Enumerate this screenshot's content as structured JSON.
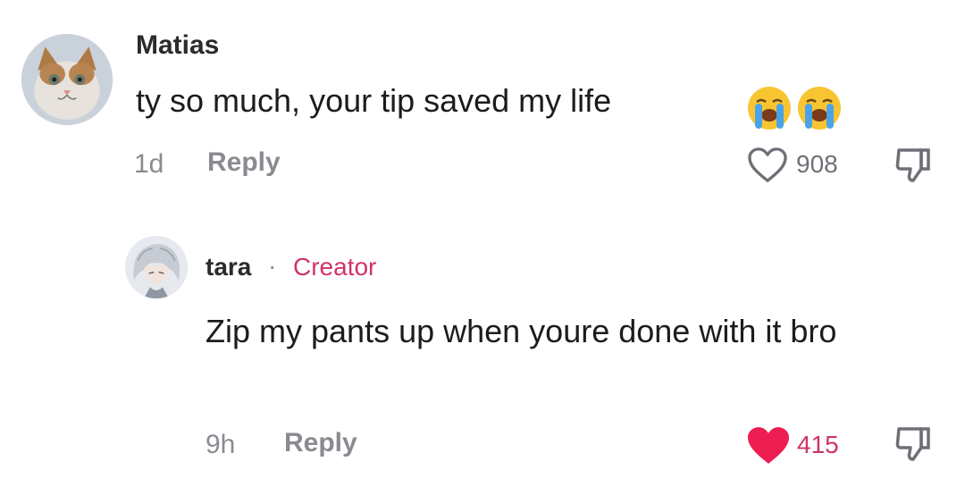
{
  "comments": [
    {
      "username": "Matias",
      "avatar_icon": "cat-avatar",
      "text": "ty so much, your tip saved my life",
      "emojis": [
        "loudly-crying-face-emoji",
        "loudly-crying-face-emoji"
      ],
      "time": "1d",
      "reply_label": "Reply",
      "likes": "908",
      "liked": false,
      "like_icon": "heart-outline-icon",
      "dislike_icon": "thumbs-down-icon"
    },
    {
      "username": "tara",
      "avatar_icon": "anime-character-avatar",
      "separator": "·",
      "badge": "Creator",
      "text": "Zip my pants up when youre done with it bro",
      "time": "9h",
      "reply_label": "Reply",
      "likes": "415",
      "liked": true,
      "like_icon": "heart-filled-icon",
      "dislike_icon": "thumbs-down-icon"
    }
  ],
  "colors": {
    "accent_pink": "#d0336a",
    "like_red": "#ee1d52",
    "muted_text": "#8a8b91"
  }
}
